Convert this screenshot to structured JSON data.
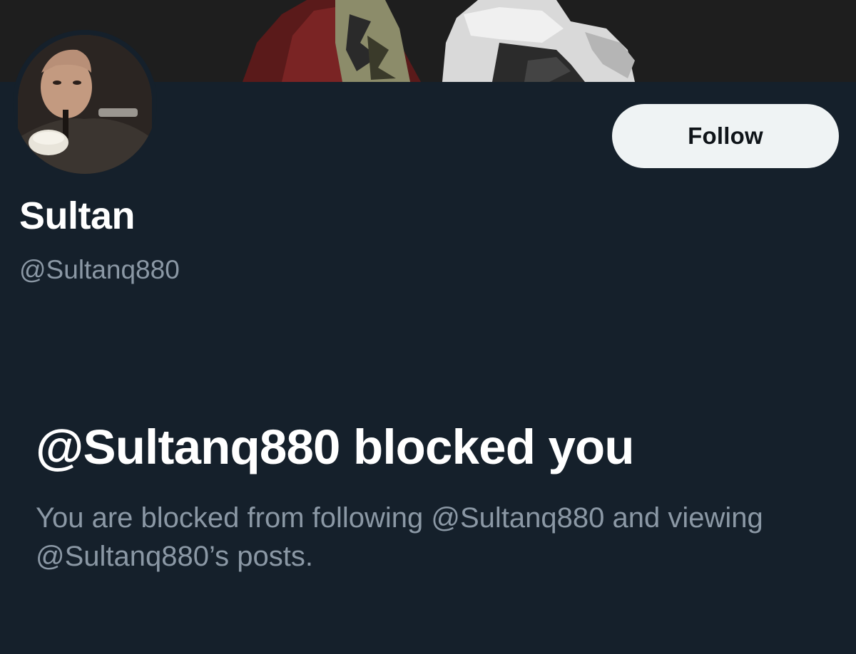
{
  "profile": {
    "display_name": "Sultan",
    "handle": "@Sultanq880",
    "follow_label": "Follow",
    "banner_image": "header-photo",
    "avatar_image": "profile-photo"
  },
  "blocked_notice": {
    "title": "@Sultanq880 blocked you",
    "description": "You are blocked from following @Sultanq880 and viewing @Sultanq880’s posts."
  },
  "colors": {
    "background": "#15202b",
    "primary_text": "#ffffff",
    "secondary_text": "#8b98a5",
    "button_bg": "#eff3f4",
    "button_text": "#0f1419"
  }
}
